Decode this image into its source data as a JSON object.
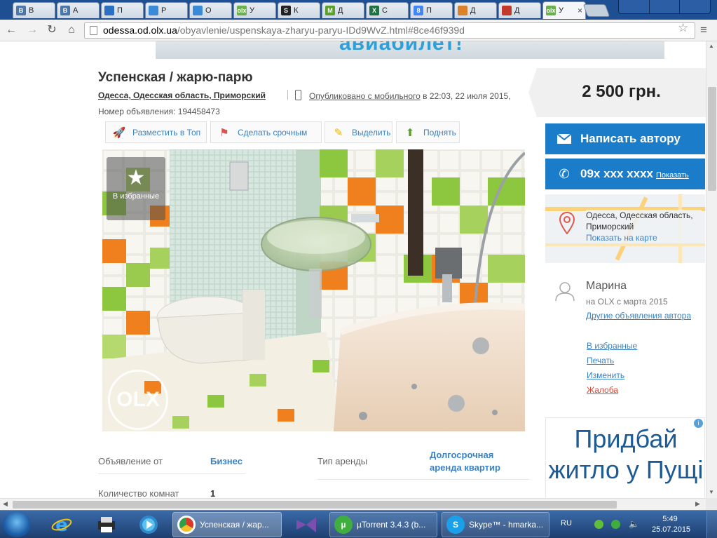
{
  "browser": {
    "tabs": [
      {
        "icon": "vk-icon",
        "fav_text": "В",
        "color": "#4a76a8",
        "label": "В"
      },
      {
        "icon": "vk-icon",
        "fav_text": "В",
        "color": "#4a76a8",
        "label": "А"
      },
      {
        "icon": "chart-icon",
        "fav_text": "",
        "color": "#2a6fc4",
        "label": "П"
      },
      {
        "icon": "eye-icon",
        "fav_text": "",
        "color": "#3a8ad8",
        "label": "Р"
      },
      {
        "icon": "eye-icon",
        "fav_text": "",
        "color": "#3a8ad8",
        "label": "О"
      },
      {
        "icon": "olx-icon",
        "fav_text": "olx",
        "color": "#6ab04c",
        "label": "У"
      },
      {
        "icon": "s-icon",
        "fav_text": "S",
        "color": "#222222",
        "label": "К"
      },
      {
        "icon": "m-icon",
        "fav_text": "M",
        "color": "#5aa02c",
        "label": "Д"
      },
      {
        "icon": "excel-icon",
        "fav_text": "X",
        "color": "#1f7244",
        "label": "С"
      },
      {
        "icon": "google-icon",
        "fav_text": "8",
        "color": "#4285f4",
        "label": "П"
      },
      {
        "icon": "cube-icon",
        "fav_text": "",
        "color": "#d9822b",
        "label": "Д"
      },
      {
        "icon": "book-icon",
        "fav_text": "",
        "color": "#c0392b",
        "label": "Д"
      },
      {
        "icon": "olx-icon",
        "fav_text": "olx",
        "color": "#6ab04c",
        "label": "У",
        "active": true
      }
    ],
    "url_host": "odessa.od.olx.ua",
    "url_path": "/obyavlenie/uspenskaya-zharyu-paryu-IDd9WvZ.html#8ce46f939d"
  },
  "banner": {
    "text": "авиабилет!"
  },
  "ad": {
    "title": "Успенская / жарю-парю",
    "location": "Одесса, Одесская область, Приморский",
    "published_link": "Опубликовано с мобильного",
    "published_rest": " в 22:03, 22 июля 2015,",
    "ad_id": "Номер объявления: 194458473"
  },
  "promo": [
    {
      "name": "promote-top-button",
      "icon": "rocket-icon",
      "glyph": "🚀",
      "label": "Разместить в Топ"
    },
    {
      "name": "make-urgent-button",
      "icon": "urgent-tag-icon",
      "glyph": "⚑",
      "label": "Сделать срочным"
    },
    {
      "name": "highlight-button",
      "icon": "marker-icon",
      "glyph": "✎",
      "label": "Выделить"
    },
    {
      "name": "bump-button",
      "icon": "arrow-up-icon",
      "glyph": "⬆",
      "label": "Поднять"
    }
  ],
  "photo": {
    "favorite_label": "В избранные",
    "watermark": "OLX"
  },
  "params": [
    {
      "label": "Объявление от",
      "value": "Бизнес"
    },
    {
      "label": "Тип аренды",
      "value": "Долгосрочная аренда квартир"
    },
    {
      "label": "Количество комнат",
      "value": "1"
    }
  ],
  "sidebar": {
    "price": "2 500 грн.",
    "write_author": "Написать автору",
    "phone": "09x xxx xxxx",
    "phone_show": "Показать",
    "map_address": "Одесса, Одесская область, Приморский",
    "map_link": "Показать на карте",
    "seller_name": "Марина",
    "seller_since": "на OLX с марта 2015",
    "seller_other": "Другие объявления автора",
    "links": [
      {
        "name": "add-to-favorites-link",
        "label": "В избранные"
      },
      {
        "name": "print-link",
        "label": "Печать"
      },
      {
        "name": "edit-link",
        "label": "Изменить"
      },
      {
        "name": "complaint-link",
        "label": "Жалоба"
      }
    ],
    "ad_text": "Придбай житло у Пущі"
  },
  "taskbar": {
    "tasks": [
      {
        "name": "task-chrome",
        "icon": "chrome-icon",
        "color": "#d9382a",
        "label": "Успенская / жар..."
      },
      {
        "name": "task-utorrent",
        "icon": "utorrent-icon",
        "color": "#3fae3f",
        "label": "µTorrent 3.4.3  (b..."
      },
      {
        "name": "task-skype",
        "icon": "skype-icon",
        "color": "#1aa0e8",
        "label": "Skype™ - hmarka..."
      }
    ],
    "lang": "RU",
    "time": "5:49",
    "date": "25.07.2015"
  }
}
